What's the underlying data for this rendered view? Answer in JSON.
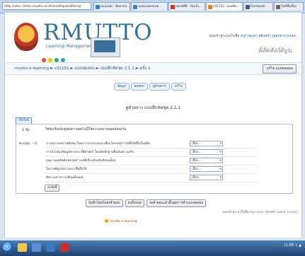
{
  "browser": {
    "address": "http://elec.chem.rmutto.ac.th/mod/quiz/attemp",
    "address_controls": "ρ - ⊠ c ×",
    "tabs": [
      {
        "label": "ออนแลต - ข้อมาจก...",
        "color": "#3a7bd5"
      },
      {
        "label": "เออนแลตออนพ ...",
        "color": "#3a7bd5"
      },
      {
        "label": "ออกพลีพี - YouTu...",
        "color": "#d93025"
      },
      {
        "label": "s31101: ออนลีค...",
        "color": "#e67e22"
      },
      {
        "label": "Facebook",
        "color": "#3b5998"
      },
      {
        "label": "ไม่มีชื่อเรื่อง",
        "color": "#666666"
      }
    ]
  },
  "header": {
    "logo_title": "RMUTTO",
    "logo_subtitle": "Learning Management System",
    "user_prefix": "คุณเข้าสู่ระบบในชื่อ",
    "user_name": "ครูกาละดา สลังหล้า (ออกจากระบบ)",
    "role_label": "พิลัดสังกัดิบูน"
  },
  "nav": {
    "breadcrumb": "rmutto e-learning ► s31101 ► แบบทดสอบ ► แบบฝึกหัดชุด 2.1.1 ► ครั้ง 1",
    "update_button": "แก้ไข แบบทดสอบ"
  },
  "quiz_tabs": [
    "ข้อมูล",
    "ผลสอบ",
    "ดูตัวอย่าง",
    "แก้ไข"
  ],
  "quiz": {
    "title": "ดูตัวอย่าง แบบฝึกหัดชุด 2.1.1",
    "info_tab": "เริ่มใหม่",
    "question_number": "1 ข้อ",
    "score_label": "คะแนน: --/1",
    "question_text": "ให้นักเรียนจับคู่ข้อความต่อไปนี้ให้ความหมายสอดคล้องกัน",
    "matches": [
      {
        "label": "การยบรวบสภาพสังคม โดยการบรรยายและเชื่อมโยงเหตุการณ์ที่เกิดขึ้นในอดีต",
        "selected": "เลือก..."
      },
      {
        "label": "การนำเสนอข้อมูลทางประวัติศาสตร์ โดยมีหลักฐานยืนยันความจริง",
        "selected": "เลือก..."
      },
      {
        "label": "อนุมานผลลัพธ์ของเหตุการณ์ที่เกี่ยวข้องกับสังคมนั้นๆ",
        "selected": "เลือก..."
      },
      {
        "label": "ไม่อาจพิสูจน์ความน่าเชื่อถือได้",
        "selected": "เลือก..."
      },
      {
        "label": "ตีความจากการเขียนทั้งหมด",
        "selected": "เลือก..."
      }
    ],
    "submit_button": "ส่งข้อนี้"
  },
  "bottom_buttons": [
    "บันทึกโดยไม่ส่งคำตอบ",
    "ส่งทั้งหมด",
    "ส่งคำตอบแล้วสิ้นสุดการทำแบบทดสอบ"
  ],
  "footer": {
    "login_info": "คุณเข้าสู่ระบบในชื่อ ครูกาละดา สลังหล้า (ออกจากระบบ)",
    "home_link": "rmutto e-learning"
  },
  "taskbar": {
    "clock": "11:58 ♫ ▲"
  }
}
